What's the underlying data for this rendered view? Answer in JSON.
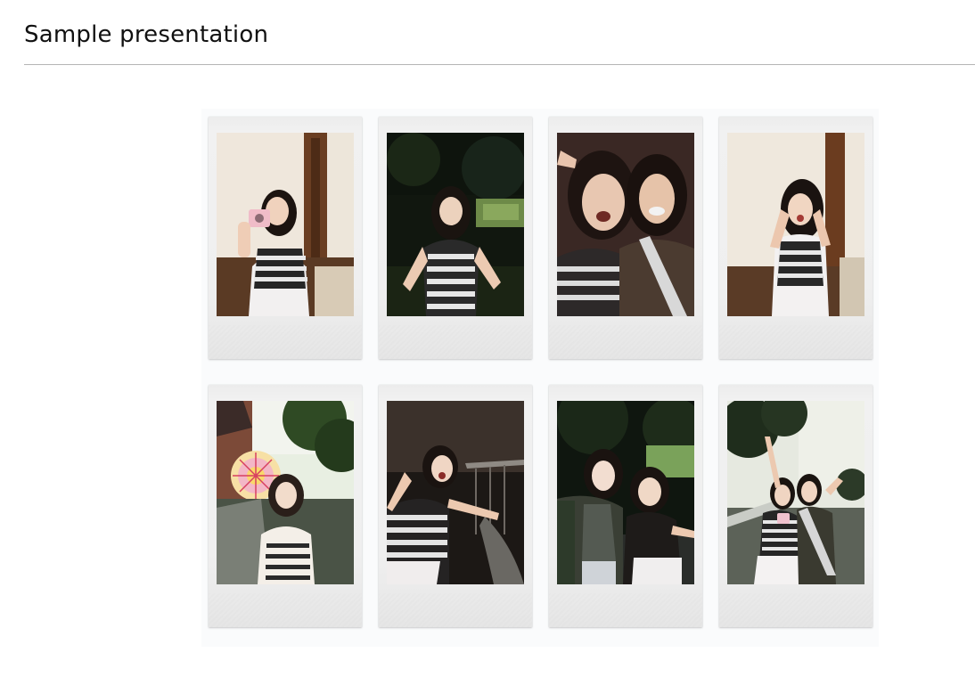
{
  "page": {
    "title": "Sample presentation"
  },
  "gallery": {
    "photos": [
      {
        "name": "photo-girl-with-pink-camera",
        "scene": "indoor-window"
      },
      {
        "name": "photo-girl-in-park-hands-on-hips",
        "scene": "dark-garden"
      },
      {
        "name": "photo-two-girls-selfie-closeup",
        "scene": "closeup-selfie"
      },
      {
        "name": "photo-girl-surprised-hands-on-face",
        "scene": "indoor-window"
      },
      {
        "name": "photo-girl-at-amusement-park",
        "scene": "ferris-wheel"
      },
      {
        "name": "photo-girl-leaning-back-laughing",
        "scene": "dark-stairs"
      },
      {
        "name": "photo-two-girls-posing-garden",
        "scene": "dark-garden"
      },
      {
        "name": "photo-two-girls-waving-outdoors",
        "scene": "sky-trees"
      }
    ]
  },
  "colors": {
    "frame": "#efefef",
    "rule": "#b5b5b5",
    "stripe_dark": "#2a2a2a"
  }
}
